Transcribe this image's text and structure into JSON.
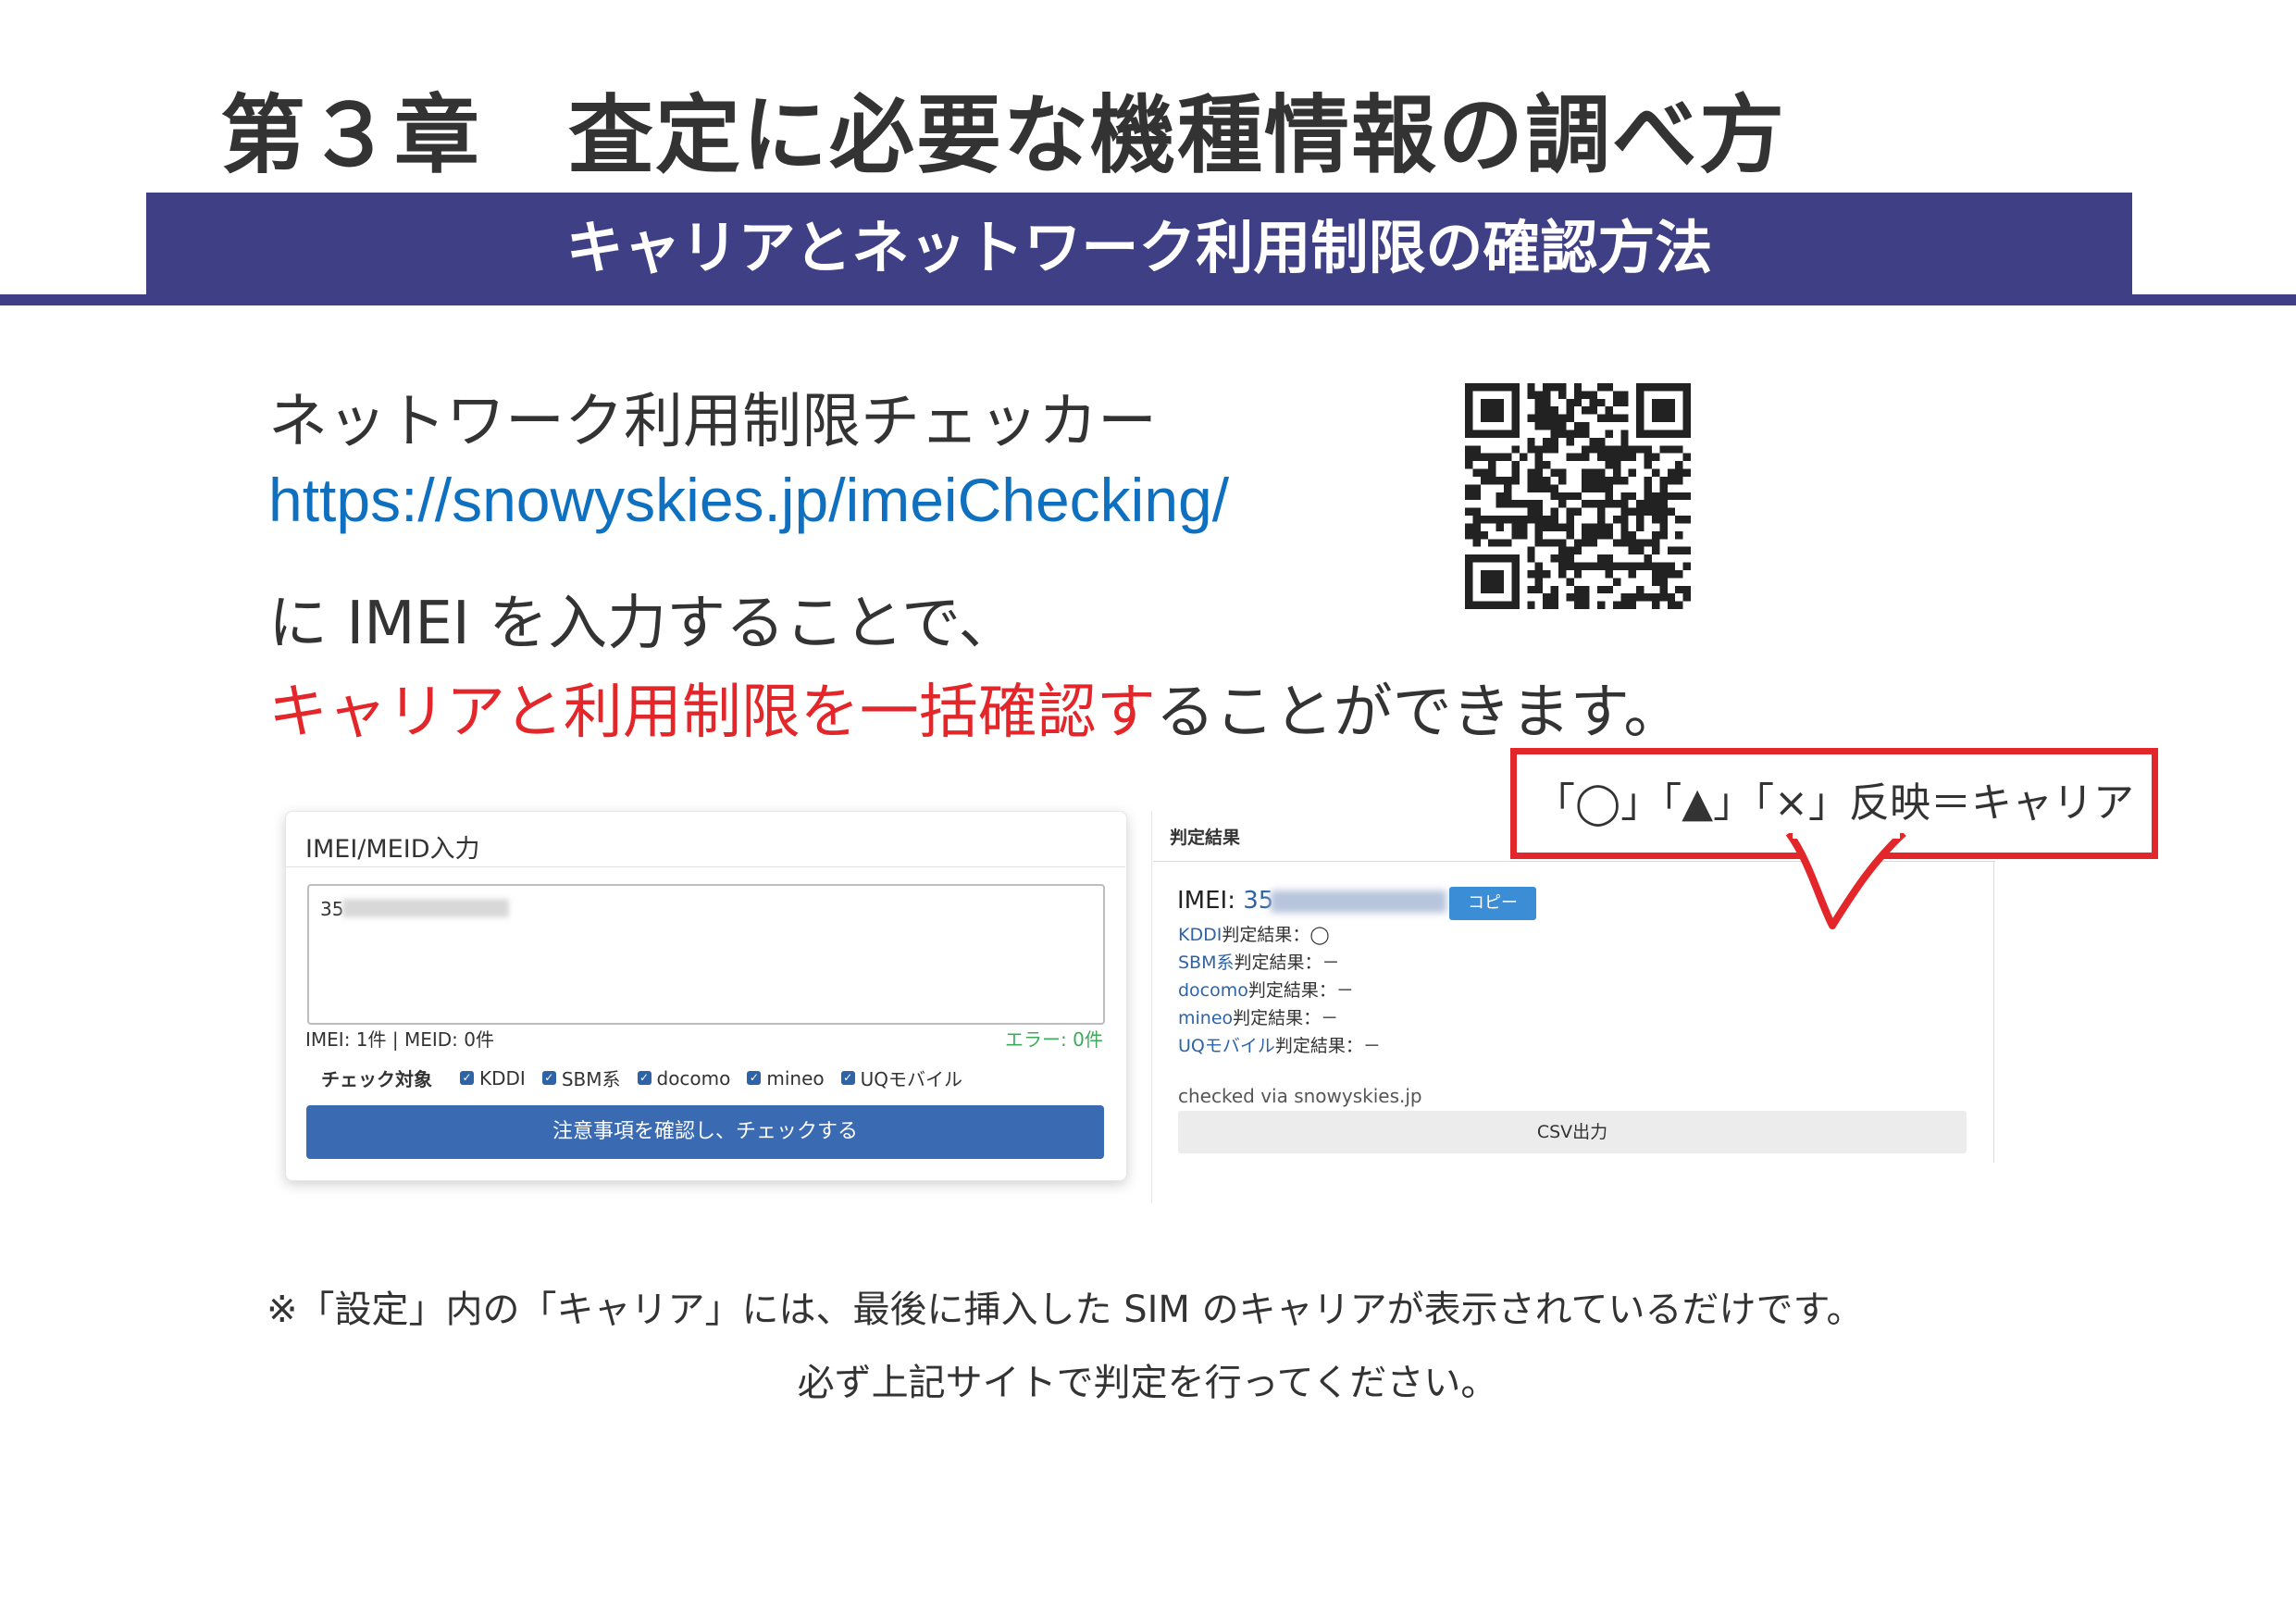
{
  "chapter_title": "第３章　査定に必要な機種情報の調べ方",
  "section_band": "キャリアとネットワーク利用制限の確認方法",
  "lead": {
    "line1": "ネットワーク利用制限チェッカー",
    "url": "https://snowyskies.jp/imeiChecking/",
    "line3": "に IMEI を入力することで、",
    "line4_red": "キャリアと利用制限を一括確認す",
    "line4_rest": "ることができます。"
  },
  "qr_code": {
    "name": "qr-code"
  },
  "input_panel": {
    "title": "IMEI/MEID入力",
    "textarea_value": "35",
    "count": "IMEI: 1件 | MEID: 0件",
    "error": "エラー: 0件",
    "check_label": "チェック対象",
    "options": [
      "KDDI",
      "SBM系",
      "docomo",
      "mineo",
      "UQモバイル"
    ],
    "submit": "注意事項を確認し、チェックする"
  },
  "result_panel": {
    "title": "判定結果",
    "imei_label": "IMEI:",
    "imei_value": "35",
    "copy": "コピー",
    "rows": [
      {
        "name": "KDDI",
        "suffix": "判定結果：◯"
      },
      {
        "name": "SBM系",
        "suffix": "判定結果：－"
      },
      {
        "name": "docomo",
        "suffix": "判定結果：－"
      },
      {
        "name": "mineo",
        "suffix": "判定結果：－"
      },
      {
        "name": "UQモバイル",
        "suffix": "判定結果：－"
      }
    ],
    "via": "checked via snowyskies.jp",
    "csv": "CSV出力"
  },
  "callout": "「◯」「▲」「×」反映＝キャリア",
  "note": {
    "line1": "※「設定」内の「キャリア」には、最後に挿入した SIM のキャリアが表示されているだけです。",
    "line2": "必ず上記サイトで判定を行ってください。"
  },
  "colors": {
    "band": "#3f3f86",
    "link": "#1070c0",
    "highlight": "#e3262a",
    "button": "#3a6ab2"
  }
}
